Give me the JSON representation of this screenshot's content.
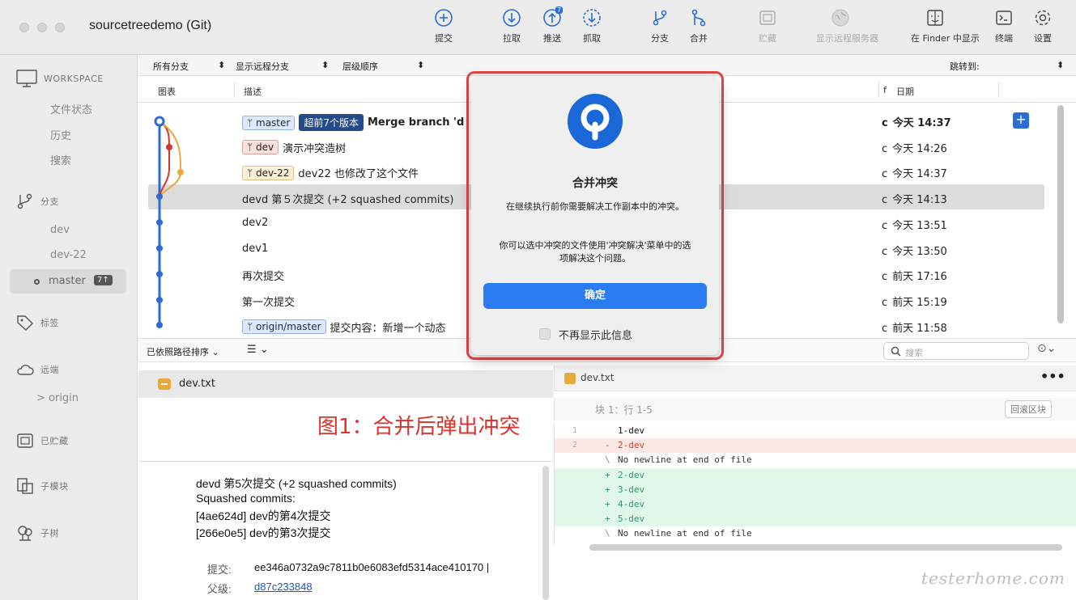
{
  "window": {
    "title": "sourcetreedemo (Git)"
  },
  "toolbar": {
    "commit": "提交",
    "pull": "拉取",
    "push": "推送",
    "push_badge": "7",
    "fetch": "抓取",
    "branch": "分支",
    "merge": "合并",
    "stash": "贮藏",
    "remote": "显示远程服务器",
    "finder": "在 Finder 中显示",
    "terminal": "终端",
    "settings": "设置"
  },
  "sidebar": {
    "workspace": "WORKSPACE",
    "workspace_items": [
      "文件状态",
      "历史",
      "搜索"
    ],
    "branches_label": "分支",
    "branches": [
      "dev",
      "dev-22"
    ],
    "current_branch": "master",
    "current_badge": "7↑",
    "tags": "标签",
    "remotes": "远端",
    "remote_origin": "> origin",
    "stashes": "已贮藏",
    "submodules": "子模块",
    "subtrees": "子树"
  },
  "filters": {
    "all_branches": "所有分支",
    "show_remote": "显示远程分支",
    "order": "层级顺序",
    "jump_to": "跳转到:"
  },
  "columns": {
    "graph": "图表",
    "description": "描述",
    "commit": "f",
    "date": "日期"
  },
  "commits": [
    {
      "tags": [
        {
          "text": "ᛘ master",
          "style": "blue"
        },
        {
          "text": "超前7个版本",
          "style": "dark"
        }
      ],
      "message": "Merge branch 'd",
      "bold": true,
      "hash": "c",
      "date": "今天 14:37"
    },
    {
      "tags": [
        {
          "text": "ᛘ dev",
          "style": "red"
        }
      ],
      "message": "演示冲突造树",
      "bold": false,
      "hash": "c",
      "date": "今天 14:26"
    },
    {
      "tags": [
        {
          "text": "ᛘ dev-22",
          "style": "orange"
        }
      ],
      "message": "dev22 也修改了这个文件",
      "bold": false,
      "hash": "c",
      "date": "今天 14:37"
    },
    {
      "tags": [],
      "message": "devd 第５次提交 (+2 squashed commits)",
      "bold": false,
      "hash": "c",
      "date": "今天 14:13"
    },
    {
      "tags": [],
      "message": "dev2",
      "bold": false,
      "hash": "c",
      "date": "今天 13:51"
    },
    {
      "tags": [],
      "message": "dev1",
      "bold": false,
      "hash": "c",
      "date": "今天 13:50"
    },
    {
      "tags": [],
      "message": "再次提交",
      "bold": false,
      "hash": "c",
      "date": "前天 17:16"
    },
    {
      "tags": [],
      "message": "第一次提交",
      "bold": false,
      "hash": "c",
      "date": "前天 15:19"
    },
    {
      "tags": [
        {
          "text": "ᛘ origin/master",
          "style": "origin"
        }
      ],
      "message": "提交内容：新增一个动态",
      "bold": false,
      "hash": "c",
      "date": "前天 11:58"
    }
  ],
  "lower_bar": {
    "sort": "已依照路径排序 ⌄",
    "view": "☰ ⌄",
    "search_placeholder": "搜索",
    "options": "⊙⌄"
  },
  "files": {
    "selected_file": "dev.txt"
  },
  "annotation": "图1：合并后弹出冲突",
  "detail": {
    "lines": [
      "devd 第5次提交 (+2 squashed commits)",
      "Squashed commits:",
      "[4ae624d] dev的第4次提交",
      "[266e0e5] dev的第3次提交"
    ],
    "commit_key": "提交:",
    "commit_value": "ee346a0732a9c7811b0e6083efd5314ace410170 |",
    "parent_key": "父级:",
    "parent_value": "d87c233848"
  },
  "diff": {
    "file": "dev.txt",
    "more": "•••",
    "hunk": "块 1：行 1-5",
    "revert_hunk": "回滚区块",
    "lines": [
      {
        "num": "1",
        "mark": " ",
        "text": "1-dev",
        "kind": "ctx"
      },
      {
        "num": "2",
        "mark": "-",
        "text": "2-dev",
        "kind": "del"
      },
      {
        "num": "",
        "mark": "\\",
        "text": "No newline at end of file",
        "kind": "nn"
      },
      {
        "num": "",
        "mark": "+",
        "text": "2-dev",
        "kind": "add"
      },
      {
        "num": "",
        "mark": "+",
        "text": "3-dev",
        "kind": "add"
      },
      {
        "num": "",
        "mark": "+",
        "text": "4-dev",
        "kind": "add"
      },
      {
        "num": "",
        "mark": "+",
        "text": "5-dev",
        "kind": "add"
      },
      {
        "num": "",
        "mark": "\\",
        "text": "No newline at end of file",
        "kind": "nn"
      }
    ]
  },
  "watermark": "testerhome.com",
  "modal": {
    "title": "合并冲突",
    "text1": "在继续执行前你需要解决工作副本中的冲突。",
    "text2": "你可以选中冲突的文件使用'冲突解决'菜单中的选项解决这个问题。",
    "ok": "确定",
    "dont_show": "不再显示此信息"
  },
  "colors": {
    "accent": "#2b7cf0",
    "graph_blue": "#2b6cd6",
    "graph_red": "#d9342b",
    "graph_orange": "#e9a93b",
    "annotation_red": "#d9342b"
  }
}
